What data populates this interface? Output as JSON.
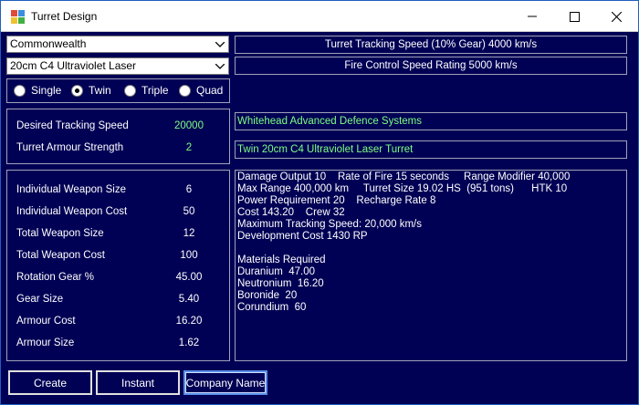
{
  "window": {
    "title": "Turret Design"
  },
  "selectors": {
    "empire": "Commonwealth",
    "weapon": "20cm C4 Ultraviolet Laser"
  },
  "turret_type": {
    "options": [
      "Single",
      "Twin",
      "Triple",
      "Quad"
    ],
    "selected": "Twin"
  },
  "inputs": {
    "desired_tracking_label": "Desired Tracking Speed",
    "desired_tracking_value": "20000",
    "armour_strength_label": "Turret Armour Strength",
    "armour_strength_value": "2"
  },
  "stats": [
    {
      "label": "Individual Weapon Size",
      "value": "6"
    },
    {
      "label": "Individual Weapon Cost",
      "value": "50"
    },
    {
      "label": "Total Weapon Size",
      "value": "12"
    },
    {
      "label": "Total Weapon Cost",
      "value": "100"
    },
    {
      "label": "Rotation Gear %",
      "value": "45.00"
    },
    {
      "label": "Gear Size",
      "value": "5.40"
    },
    {
      "label": "Armour Cost",
      "value": "16.20"
    },
    {
      "label": "Armour Size",
      "value": "1.62"
    }
  ],
  "info": {
    "tracking_speed": "Turret Tracking Speed (10% Gear) 4000 km/s",
    "fire_control": "Fire Control Speed Rating 5000 km/s",
    "company": "Whitehead Advanced Defence Systems",
    "design_name": "Twin 20cm C4 Ultraviolet Laser Turret"
  },
  "details": [
    "Damage Output 10    Rate of Fire 15 seconds     Range Modifier 40,000",
    "Max Range 400,000 km     Turret Size 19.02 HS  (951 tons)      HTK 10",
    "Power Requirement 20    Recharge Rate 8",
    "Cost 143.20    Crew 32",
    "Maximum Tracking Speed: 20,000 km/s",
    "Development Cost 1430 RP",
    "",
    "Materials Required",
    "Duranium  47.00",
    "Neutronium  16.20",
    "Boronide  20",
    "Corundium  60"
  ],
  "buttons": {
    "create": "Create",
    "instant": "Instant",
    "company_name": "Company Name"
  },
  "colors": {
    "background": "#000055",
    "highlight_text": "#7fff7f",
    "value_text": "#7fff7f"
  }
}
